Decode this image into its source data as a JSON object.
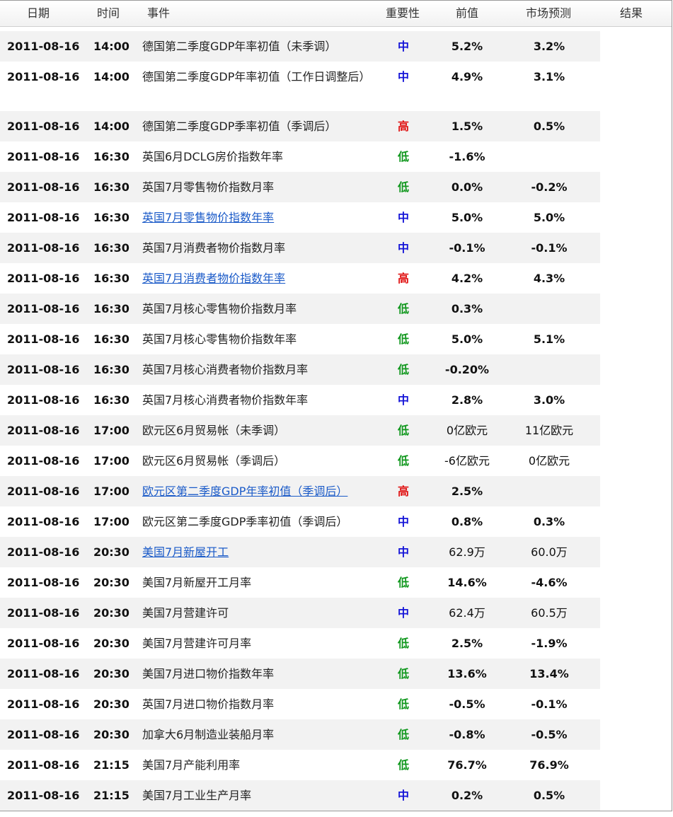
{
  "header": {
    "date": "日期",
    "time": "时间",
    "event": "事件",
    "importance": "重要性",
    "previous": "前值",
    "forecast": "市场预测",
    "result": "结果"
  },
  "rows": [
    {
      "date": "2011-08-16",
      "time": "14:00",
      "event": "德国第二季度GDP年率初值（未季调）",
      "importance": "中",
      "level": "mid",
      "previous": "5.2%",
      "forecast": "3.2%",
      "link": false
    },
    {
      "date": "2011-08-16",
      "time": "14:00",
      "event": "德国第二季度GDP年率初值（工作日调整后）",
      "importance": "中",
      "level": "mid",
      "previous": "4.9%",
      "forecast": "3.1%",
      "link": false
    },
    {
      "date": "2011-08-16",
      "time": "14:00",
      "event": "德国第二季度GDP季率初值（季调后）",
      "importance": "高",
      "level": "high",
      "previous": "1.5%",
      "forecast": "0.5%",
      "link": false
    },
    {
      "date": "2011-08-16",
      "time": "16:30",
      "event": "英国6月DCLG房价指数年率",
      "importance": "低",
      "level": "low",
      "previous": "-1.6%",
      "forecast": "",
      "link": false
    },
    {
      "date": "2011-08-16",
      "time": "16:30",
      "event": "英国7月零售物价指数月率",
      "importance": "低",
      "level": "low",
      "previous": "0.0%",
      "forecast": "-0.2%",
      "link": false
    },
    {
      "date": "2011-08-16",
      "time": "16:30",
      "event": "英国7月零售物价指数年率",
      "importance": "中",
      "level": "mid",
      "previous": "5.0%",
      "forecast": "5.0%",
      "link": true
    },
    {
      "date": "2011-08-16",
      "time": "16:30",
      "event": "英国7月消费者物价指数月率",
      "importance": "中",
      "level": "mid",
      "previous": "-0.1%",
      "forecast": "-0.1%",
      "link": false
    },
    {
      "date": "2011-08-16",
      "time": "16:30",
      "event": "英国7月消费者物价指数年率",
      "importance": "高",
      "level": "high",
      "previous": "4.2%",
      "forecast": "4.3%",
      "link": true
    },
    {
      "date": "2011-08-16",
      "time": "16:30",
      "event": "英国7月核心零售物价指数月率",
      "importance": "低",
      "level": "low",
      "previous": "0.3%",
      "forecast": "",
      "link": false
    },
    {
      "date": "2011-08-16",
      "time": "16:30",
      "event": "英国7月核心零售物价指数年率",
      "importance": "低",
      "level": "low",
      "previous": "5.0%",
      "forecast": "5.1%",
      "link": false
    },
    {
      "date": "2011-08-16",
      "time": "16:30",
      "event": "英国7月核心消费者物价指数月率",
      "importance": "低",
      "level": "low",
      "previous": "-0.20%",
      "forecast": "",
      "link": false
    },
    {
      "date": "2011-08-16",
      "time": "16:30",
      "event": "英国7月核心消费者物价指数年率",
      "importance": "中",
      "level": "mid",
      "previous": "2.8%",
      "forecast": "3.0%",
      "link": false
    },
    {
      "date": "2011-08-16",
      "time": "17:00",
      "event": "欧元区6月贸易帐（未季调）",
      "importance": "低",
      "level": "low",
      "previous": "0亿欧元",
      "forecast": "11亿欧元",
      "link": false
    },
    {
      "date": "2011-08-16",
      "time": "17:00",
      "event": "欧元区6月贸易帐（季调后）",
      "importance": "低",
      "level": "low",
      "previous": "-6亿欧元",
      "forecast": "0亿欧元",
      "link": false
    },
    {
      "date": "2011-08-16",
      "time": "17:00",
      "event": "欧元区第二季度GDP年率初值（季调后）",
      "importance": "高",
      "level": "high",
      "previous": "2.5%",
      "forecast": "",
      "link": true
    },
    {
      "date": "2011-08-16",
      "time": "17:00",
      "event": "欧元区第二季度GDP季率初值（季调后）",
      "importance": "中",
      "level": "mid",
      "previous": "0.8%",
      "forecast": "0.3%",
      "link": false
    },
    {
      "date": "2011-08-16",
      "time": "20:30",
      "event": "美国7月新屋开工",
      "importance": "中",
      "level": "mid",
      "previous": "62.9万",
      "forecast": "60.0万",
      "link": true
    },
    {
      "date": "2011-08-16",
      "time": "20:30",
      "event": "美国7月新屋开工月率",
      "importance": "低",
      "level": "low",
      "previous": "14.6%",
      "forecast": "-4.6%",
      "link": false
    },
    {
      "date": "2011-08-16",
      "time": "20:30",
      "event": "美国7月营建许可",
      "importance": "中",
      "level": "mid",
      "previous": "62.4万",
      "forecast": "60.5万",
      "link": false
    },
    {
      "date": "2011-08-16",
      "time": "20:30",
      "event": "美国7月营建许可月率",
      "importance": "低",
      "level": "low",
      "previous": "2.5%",
      "forecast": "-1.9%",
      "link": false
    },
    {
      "date": "2011-08-16",
      "time": "20:30",
      "event": "美国7月进口物价指数年率",
      "importance": "低",
      "level": "low",
      "previous": "13.6%",
      "forecast": "13.4%",
      "link": false
    },
    {
      "date": "2011-08-16",
      "time": "20:30",
      "event": "英国7月进口物价指数月率",
      "importance": "低",
      "level": "low",
      "previous": "-0.5%",
      "forecast": "-0.1%",
      "link": false
    },
    {
      "date": "2011-08-16",
      "time": "20:30",
      "event": "加拿大6月制造业装船月率",
      "importance": "低",
      "level": "low",
      "previous": "-0.8%",
      "forecast": "-0.5%",
      "link": false
    },
    {
      "date": "2011-08-16",
      "time": "21:15",
      "event": "美国7月产能利用率",
      "importance": "低",
      "level": "low",
      "previous": "76.7%",
      "forecast": "76.9%",
      "link": false
    },
    {
      "date": "2011-08-16",
      "time": "21:15",
      "event": "美国7月工业生产月率",
      "importance": "中",
      "level": "mid",
      "previous": "0.2%",
      "forecast": "0.5%",
      "link": false
    }
  ]
}
